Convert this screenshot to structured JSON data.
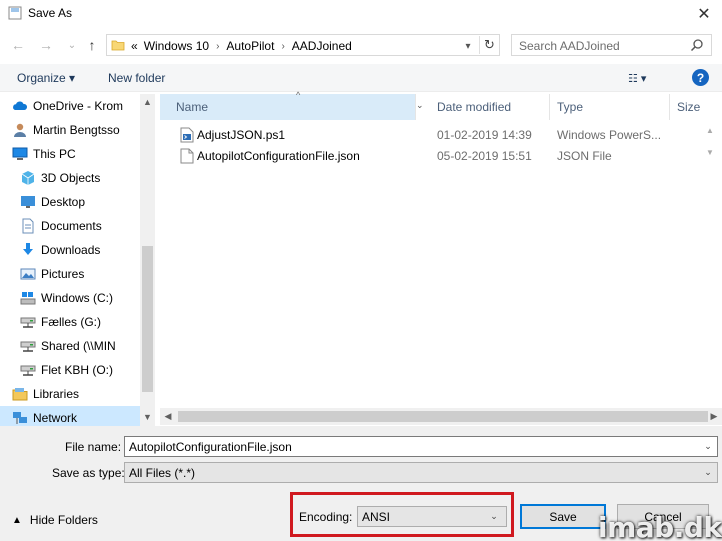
{
  "window": {
    "title": "Save As",
    "close_glyph": "✕"
  },
  "nav": {
    "back_glyph": "←",
    "forward_glyph": "→",
    "recent_glyph": "⌄",
    "up_glyph": "↑",
    "address": {
      "overflow": "«",
      "crumbs": [
        "Windows 10",
        "AutoPilot",
        "AADJoined"
      ],
      "separator": "›",
      "dropdown_glyph": "▾",
      "refresh_glyph": "↻"
    },
    "search": {
      "placeholder": "Search AADJoined"
    }
  },
  "toolbar": {
    "organize_label": "Organize ▾",
    "new_folder_label": "New folder",
    "view_glyph": "☷ ▾",
    "help_glyph": "?"
  },
  "sidebar": {
    "items": [
      {
        "label": "OneDrive - Krom",
        "icon": "onedrive-icon",
        "indent": 12
      },
      {
        "label": "Martin Bengtsso",
        "icon": "user-icon",
        "indent": 12
      },
      {
        "label": "This PC",
        "icon": "pc-icon",
        "indent": 12
      },
      {
        "label": "3D Objects",
        "icon": "3d-objects-icon",
        "indent": 20
      },
      {
        "label": "Desktop",
        "icon": "desktop-icon",
        "indent": 20
      },
      {
        "label": "Documents",
        "icon": "documents-icon",
        "indent": 20
      },
      {
        "label": "Downloads",
        "icon": "downloads-icon",
        "indent": 20
      },
      {
        "label": "Pictures",
        "icon": "pictures-icon",
        "indent": 20
      },
      {
        "label": "Windows (C:)",
        "icon": "drive-icon",
        "indent": 20
      },
      {
        "label": "Fælles (G:)",
        "icon": "network-drive-icon",
        "indent": 20
      },
      {
        "label": "Shared (\\\\MIN",
        "icon": "network-drive-icon",
        "indent": 20
      },
      {
        "label": "Flet KBH (O:)",
        "icon": "network-drive-icon",
        "indent": 20
      },
      {
        "label": "Libraries",
        "icon": "libraries-icon",
        "indent": 12
      },
      {
        "label": "Network",
        "icon": "network-icon",
        "indent": 12
      }
    ],
    "scroll_up": "▲",
    "scroll_down": "▼"
  },
  "filelist": {
    "columns": [
      {
        "label": "Name"
      },
      {
        "label": "Date modified"
      },
      {
        "label": "Type"
      },
      {
        "label": "Size"
      }
    ],
    "sort_caret": "^",
    "rows": [
      {
        "name": "AdjustJSON.ps1",
        "date": "01-02-2019 14:39",
        "type": "Windows PowerS...",
        "icon": "powershell-file-icon"
      },
      {
        "name": "AutopilotConfigurationFile.json",
        "date": "05-02-2019 15:51",
        "type": "JSON File",
        "icon": "json-file-icon"
      }
    ],
    "hscroll_left": "◀",
    "hscroll_right": "▶"
  },
  "bottom": {
    "filename_label": "File name:",
    "filename_value": "AutopilotConfigurationFile.json",
    "savetype_label": "Save as type:",
    "savetype_value": "All Files  (*.*)",
    "hide_folders_label": "Hide Folders",
    "encoding_label": "Encoding:",
    "encoding_value": "ANSI",
    "save_label": "Save",
    "cancel_label": "Cancel",
    "combo_glyph": "⌄"
  },
  "watermark": "imab.dk",
  "colors": {
    "accent": "#0078d7",
    "highlight": "#d0191f",
    "selected": "#cce8ff"
  }
}
